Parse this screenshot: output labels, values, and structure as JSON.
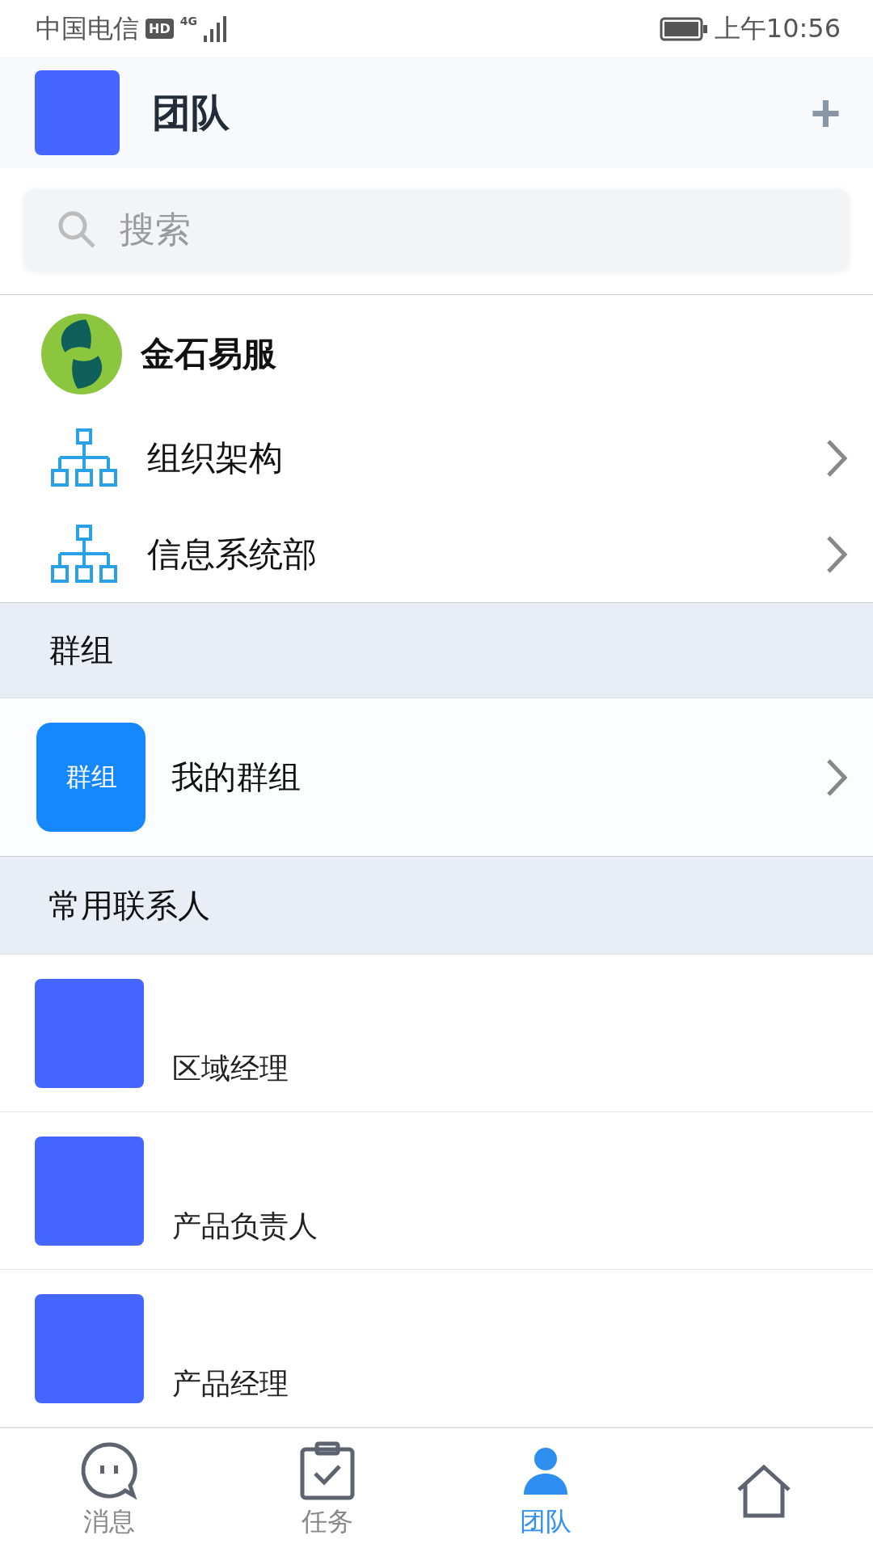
{
  "status_bar": {
    "carrier": "中国电信",
    "hd": "HD",
    "network": "4G",
    "time": "上午10:56"
  },
  "header": {
    "title": "团队",
    "add": "+"
  },
  "search": {
    "placeholder": "搜索"
  },
  "company": {
    "name": "金石易服"
  },
  "departments": [
    {
      "label": "组织架构"
    },
    {
      "label": "信息系统部"
    }
  ],
  "groups_section": {
    "title": "群组",
    "items": [
      {
        "badge": "群组",
        "label": "我的群组"
      }
    ]
  },
  "contacts_section": {
    "title": "常用联系人",
    "items": [
      {
        "role": "区域经理"
      },
      {
        "role": "产品负责人"
      },
      {
        "role": "产品经理"
      }
    ]
  },
  "tabs": [
    {
      "kind": "chat",
      "label": "消息",
      "selected": false
    },
    {
      "kind": "task",
      "label": "任务",
      "selected": false
    },
    {
      "kind": "team",
      "label": "团队",
      "selected": true
    },
    {
      "kind": "home",
      "selected": false
    }
  ]
}
